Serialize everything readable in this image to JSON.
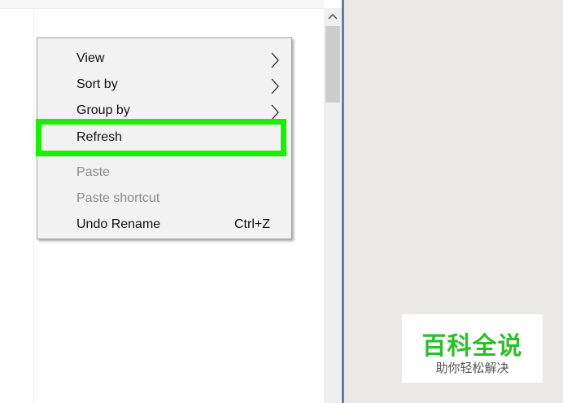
{
  "context_menu": {
    "items": [
      {
        "label": "View",
        "submenu": true,
        "disabled": false
      },
      {
        "label": "Sort by",
        "submenu": true,
        "disabled": false
      },
      {
        "label": "Group by",
        "submenu": true,
        "disabled": false
      },
      {
        "label": "Refresh",
        "submenu": false,
        "disabled": false,
        "highlighted": true
      },
      {
        "label": "Paste",
        "submenu": false,
        "disabled": true
      },
      {
        "label": "Paste shortcut",
        "submenu": false,
        "disabled": true
      },
      {
        "label": "Undo Rename",
        "shortcut": "Ctrl+Z",
        "submenu": false,
        "disabled": false
      }
    ]
  },
  "highlight_color": "#18f000",
  "scrollbar": {
    "up_icon": "chevron-up-icon"
  },
  "watermark": {
    "title": "百科全说",
    "subtitle": "助你轻松解决",
    "color": "#2dbe2b"
  }
}
